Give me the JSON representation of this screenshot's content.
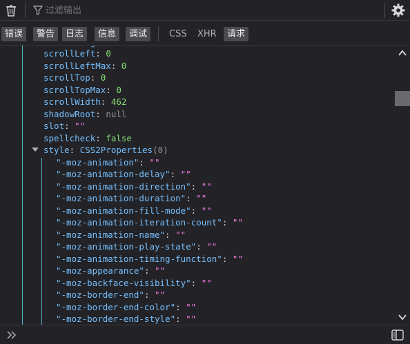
{
  "toolbar": {
    "filter_placeholder": "过滤输出",
    "icons": [
      "trash-icon",
      "filter-icon",
      "gear-icon"
    ]
  },
  "filter_buttons": [
    {
      "label": "错误",
      "active": true
    },
    {
      "label": "警告",
      "active": true
    },
    {
      "label": "日志",
      "active": true
    },
    {
      "label": "信息",
      "active": true
    },
    {
      "label": "调试",
      "active": true
    },
    {
      "label": "CSS",
      "active": false
    },
    {
      "label": "XHR",
      "active": false
    },
    {
      "label": "请求",
      "active": true
    }
  ],
  "properties": [
    {
      "key": "scrollLeft",
      "value": "0",
      "type": "number"
    },
    {
      "key": "scrollLeftMax",
      "value": "0",
      "type": "number"
    },
    {
      "key": "scrollTop",
      "value": "0",
      "type": "number"
    },
    {
      "key": "scrollTopMax",
      "value": "0",
      "type": "number"
    },
    {
      "key": "scrollWidth",
      "value": "462",
      "type": "number"
    },
    {
      "key": "shadowRoot",
      "value": "null",
      "type": "null"
    },
    {
      "key": "slot",
      "value": "\"\"",
      "type": "string"
    },
    {
      "key": "spellcheck",
      "value": "false",
      "type": "bool"
    }
  ],
  "style_node": {
    "key": "style",
    "value": "CSS2Properties",
    "count": "(0)",
    "expanded": true
  },
  "style_properties": [
    {
      "key": "\"-moz-animation\"",
      "value": "\"\""
    },
    {
      "key": "\"-moz-animation-delay\"",
      "value": "\"\""
    },
    {
      "key": "\"-moz-animation-direction\"",
      "value": "\"\""
    },
    {
      "key": "\"-moz-animation-duration\"",
      "value": "\"\""
    },
    {
      "key": "\"-moz-animation-fill-mode\"",
      "value": "\"\""
    },
    {
      "key": "\"-moz-animation-iteration-count\"",
      "value": "\"\""
    },
    {
      "key": "\"-moz-animation-name\"",
      "value": "\"\""
    },
    {
      "key": "\"-moz-animation-play-state\"",
      "value": "\"\""
    },
    {
      "key": "\"-moz-animation-timing-function\"",
      "value": "\"\""
    },
    {
      "key": "\"-moz-appearance\"",
      "value": "\"\""
    },
    {
      "key": "\"-moz-backface-visibility\"",
      "value": "\"\""
    },
    {
      "key": "\"-moz-border-end\"",
      "value": "\"\""
    },
    {
      "key": "\"-moz-border-end-color\"",
      "value": "\"\""
    },
    {
      "key": "\"-moz-border-end-style\"",
      "value": "\"\""
    }
  ],
  "colors": {
    "background": "#232327",
    "key": "#75bfff",
    "number": "#86de74",
    "string": "#ff7de9",
    "null": "#939395",
    "guide": "#4fb0c6"
  }
}
